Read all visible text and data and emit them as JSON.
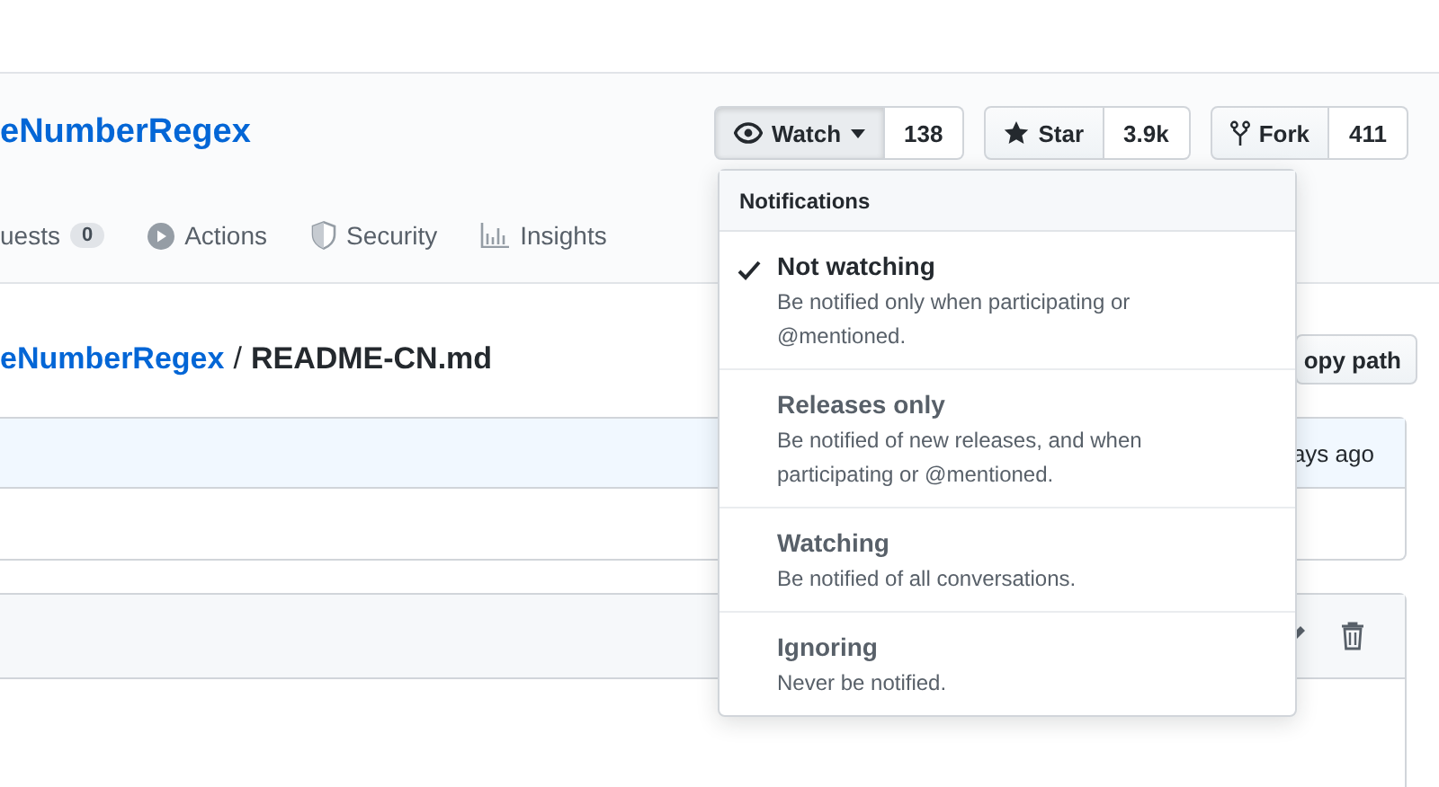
{
  "repo": {
    "name": "eNumberRegex"
  },
  "social": [
    {
      "kind": "watch",
      "label": "Watch",
      "count": "138",
      "pressed": true
    },
    {
      "kind": "star",
      "label": "Star",
      "count": "3.9k",
      "pressed": false
    },
    {
      "kind": "fork",
      "label": "Fork",
      "count": "411",
      "pressed": false
    }
  ],
  "tabs": [
    {
      "kind": "none",
      "label": "uests",
      "counter": "0"
    },
    {
      "kind": "play",
      "label": "Actions"
    },
    {
      "kind": "shield",
      "label": "Security"
    },
    {
      "kind": "graph",
      "label": "Insights"
    }
  ],
  "breadcrumb": {
    "repo": "eNumberRegex",
    "separator": "/",
    "file": "README-CN.md"
  },
  "copy_button": "opy path",
  "commit": {
    "time": "ays ago"
  },
  "notifications": {
    "title": "Notifications",
    "items": [
      {
        "title": "Not watching",
        "description": "Be notified only when participating or @mentioned.",
        "selected": true
      },
      {
        "title": "Releases only",
        "description": "Be notified of new releases, and when participating or @mentioned.",
        "selected": false
      },
      {
        "title": "Watching",
        "description": "Be notified of all conversations.",
        "selected": false
      },
      {
        "title": "Ignoring",
        "description": "Never be notified.",
        "selected": false
      }
    ]
  }
}
